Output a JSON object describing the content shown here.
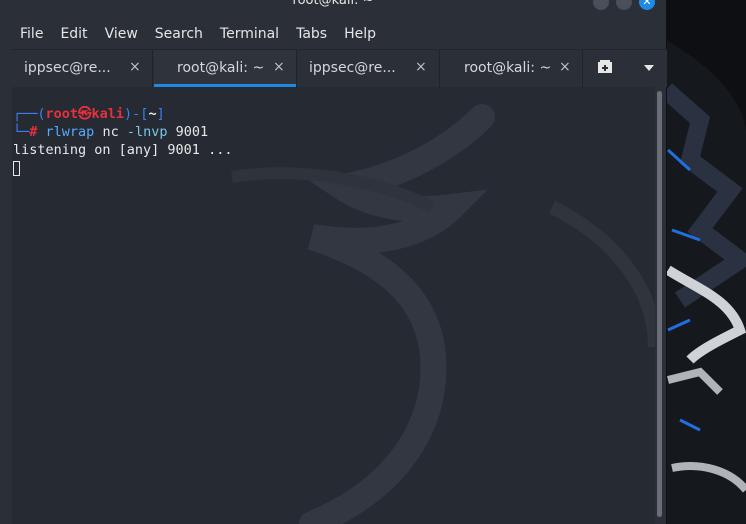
{
  "window": {
    "title": "root@kali: ~"
  },
  "menu": [
    "File",
    "Edit",
    "View",
    "Search",
    "Terminal",
    "Tabs",
    "Help"
  ],
  "tabs": [
    {
      "label": "ippsec@re...",
      "close": "×",
      "active": false
    },
    {
      "label": "root@kali: ~",
      "close": "×",
      "active": true
    },
    {
      "label": "ippsec@re...",
      "close": "×",
      "active": false
    },
    {
      "label": "root@kali: ~",
      "close": "×",
      "active": false
    }
  ],
  "terminal": {
    "prompt_top_open": "┌──(",
    "user": "root",
    "at_symbol": "㉿",
    "host": "kali",
    "prompt_mid": ")-[",
    "path": "~",
    "prompt_close": "]",
    "prompt_bottom": "└─",
    "hash": "#",
    "command": "rlwrap",
    "args": "nc",
    "flag": "-lnvp",
    "port": "9001",
    "output": "listening on [any] 9001 ..."
  },
  "colors": {
    "accent": "#1f8ae6",
    "prompt_blue": "#3c7ff5",
    "prompt_red": "#e8303c",
    "terminal_bg": "#262a33"
  },
  "icons": {
    "minimize": "minimize-icon",
    "maximize": "maximize-icon",
    "close": "close-icon",
    "new_tab": "new-tab-icon",
    "tab_menu": "chevron-down-icon"
  }
}
